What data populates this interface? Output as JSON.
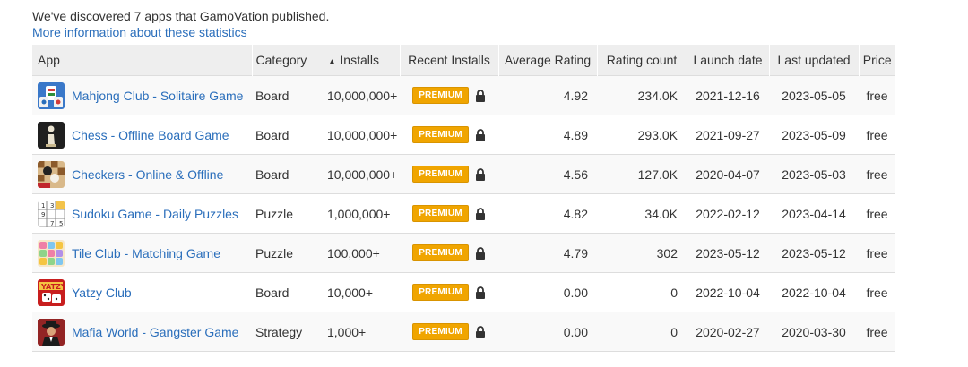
{
  "intro_text": "We've discovered 7 apps that GamoVation published.",
  "more_info_link": "More information about these statistics",
  "columns": {
    "app": "App",
    "category": "Category",
    "installs": "Installs",
    "installs_sort_icon": "▲",
    "recent_installs": "Recent Installs",
    "average_rating": "Average Rating",
    "rating_count": "Rating count",
    "launch_date": "Launch date",
    "last_updated": "Last updated",
    "price": "Price"
  },
  "premium_label": "PREMIUM",
  "apps": [
    {
      "name": "Mahjong Club - Solitaire Game",
      "icon": "mahjong-icon",
      "category": "Board",
      "installs": "10,000,000+",
      "average_rating": "4.92",
      "rating_count": "234.0K",
      "launch_date": "2021-12-16",
      "last_updated": "2023-05-05",
      "price": "free"
    },
    {
      "name": "Chess - Offline Board Game",
      "icon": "chess-icon",
      "category": "Board",
      "installs": "10,000,000+",
      "average_rating": "4.89",
      "rating_count": "293.0K",
      "launch_date": "2021-09-27",
      "last_updated": "2023-05-09",
      "price": "free"
    },
    {
      "name": "Checkers - Online & Offline",
      "icon": "checkers-icon",
      "category": "Board",
      "installs": "10,000,000+",
      "average_rating": "4.56",
      "rating_count": "127.0K",
      "launch_date": "2020-04-07",
      "last_updated": "2023-05-03",
      "price": "free"
    },
    {
      "name": "Sudoku Game - Daily Puzzles",
      "icon": "sudoku-icon",
      "category": "Puzzle",
      "installs": "1,000,000+",
      "average_rating": "4.82",
      "rating_count": "34.0K",
      "launch_date": "2022-02-12",
      "last_updated": "2023-04-14",
      "price": "free"
    },
    {
      "name": "Tile Club - Matching Game",
      "icon": "tile-icon",
      "category": "Puzzle",
      "installs": "100,000+",
      "average_rating": "4.79",
      "rating_count": "302",
      "launch_date": "2023-05-12",
      "last_updated": "2023-05-12",
      "price": "free"
    },
    {
      "name": "Yatzy Club",
      "icon": "yatzy-icon",
      "category": "Board",
      "installs": "10,000+",
      "average_rating": "0.00",
      "rating_count": "0",
      "launch_date": "2022-10-04",
      "last_updated": "2022-10-04",
      "price": "free"
    },
    {
      "name": "Mafia World - Gangster Game",
      "icon": "mafia-icon",
      "category": "Strategy",
      "installs": "1,000+",
      "average_rating": "0.00",
      "rating_count": "0",
      "launch_date": "2020-02-27",
      "last_updated": "2020-03-30",
      "price": "free"
    }
  ],
  "colors": {
    "link": "#2a6ebb",
    "premium_badge": "#f0a500",
    "header_bg": "#eeeeee"
  }
}
